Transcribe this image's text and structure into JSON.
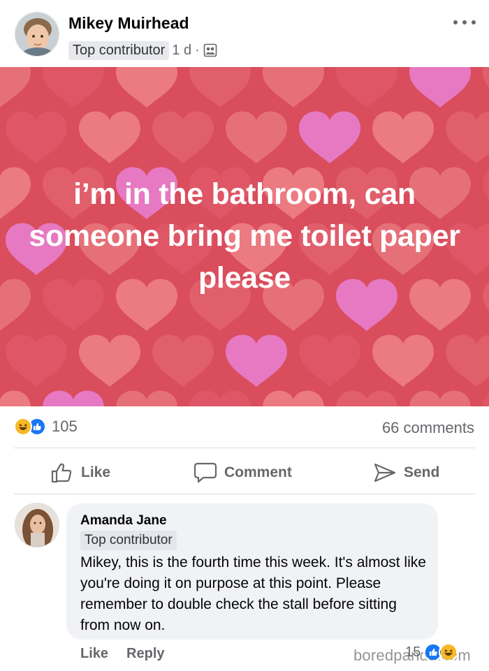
{
  "post": {
    "author": "Mikey Muirhead",
    "badge": "Top contributor",
    "time": "1 d",
    "separator": "·",
    "audience_icon": "friends-icon",
    "more_icon": "more-horizontal-icon",
    "text": "i’m in the bathroom, can someone bring me toilet paper please",
    "background_color": "#d94d5d",
    "text_color": "#ffffff"
  },
  "stats": {
    "reaction_icons": [
      "haha-icon",
      "like-icon"
    ],
    "reaction_count": "105",
    "comments": "66 comments"
  },
  "actions": {
    "like": "Like",
    "comment": "Comment",
    "send": "Send"
  },
  "comment": {
    "author": "Amanda Jane",
    "badge": "Top contributor",
    "text": "Mikey, this is the fourth time this week. It's almost like you're doing it on purpose at this point. Please remember to double check the stall before sitting from now on.",
    "like": "Like",
    "reply": "Reply",
    "reaction_count": "15",
    "reaction_icons": [
      "like-icon",
      "haha-icon"
    ]
  },
  "watermark": "boredpanda.com",
  "colors": {
    "facebook_blue": "#1877f2",
    "haha_yellow": "#f7b928",
    "secondary_text": "#65676b"
  }
}
